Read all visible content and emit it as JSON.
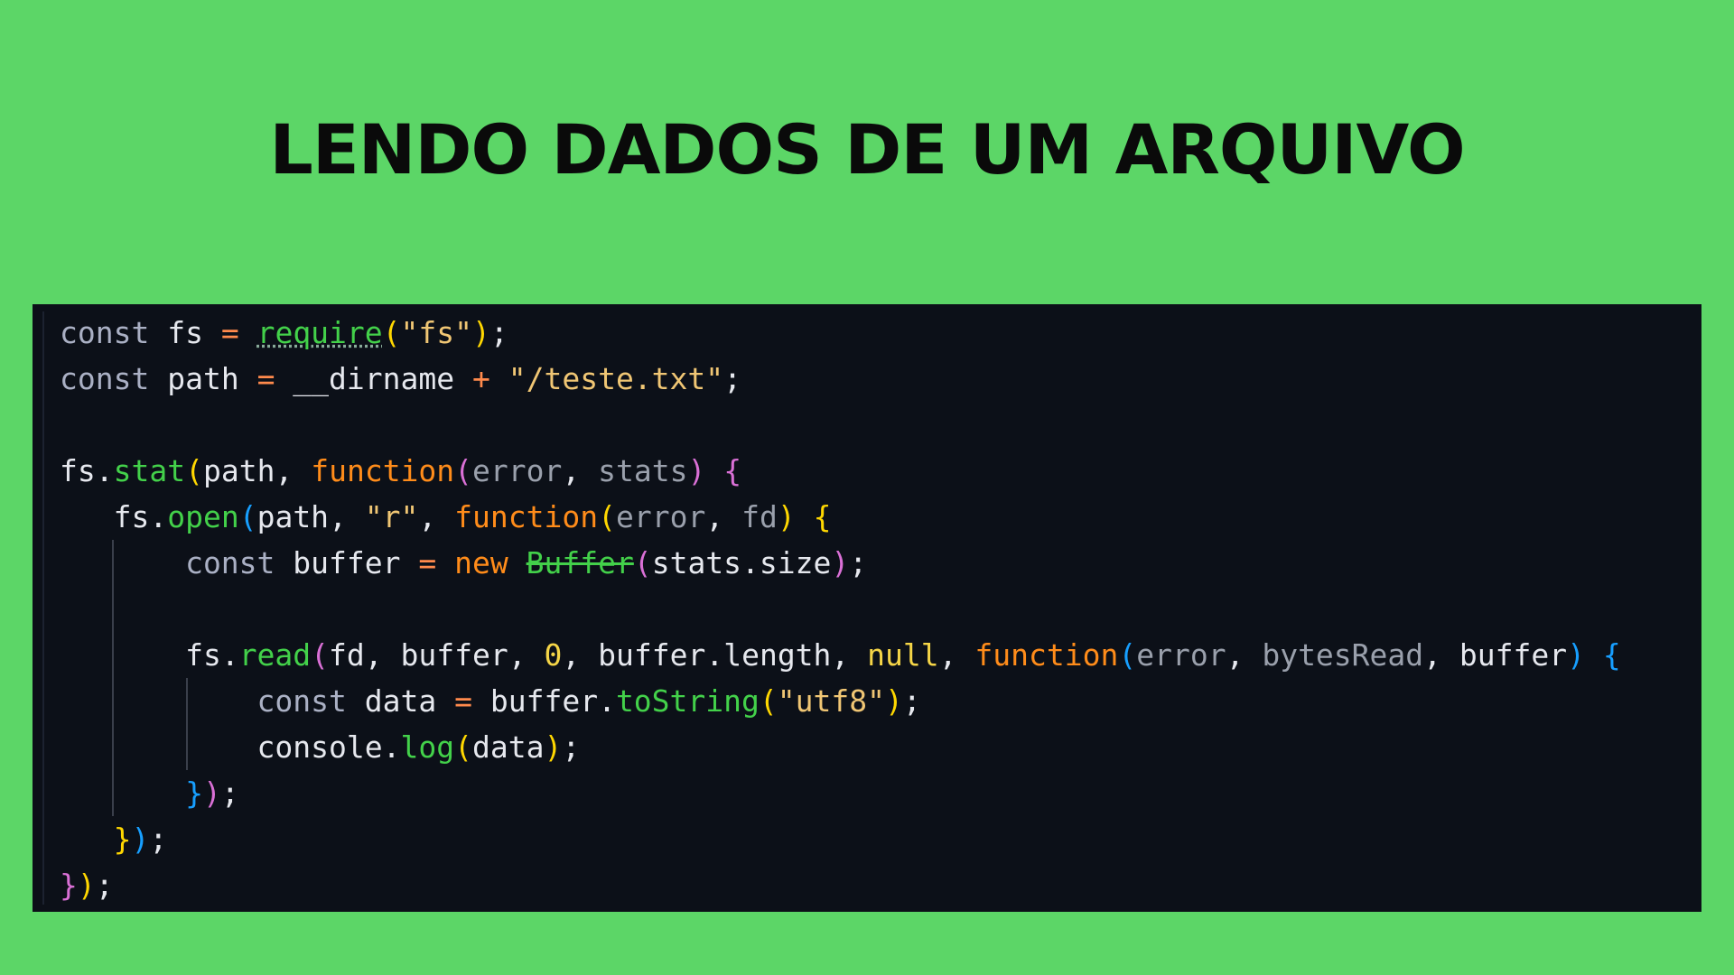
{
  "page": {
    "title": "LENDO DADOS DE UM ARQUIVO"
  },
  "colors": {
    "background": "#5cd667",
    "editor_background": "#0c1018",
    "keyword_const": "#aab0c4",
    "identifier": "#e6e8ee",
    "operator": "#ff8a4c",
    "method": "#43d14a",
    "string": "#f0c674",
    "function_keyword": "#ff8c1a",
    "parameter": "#9aa0ac",
    "number_null": "#f5d547",
    "bracket_level_1": "#ffd700",
    "bracket_level_2": "#da70d6",
    "bracket_level_3": "#179fff"
  },
  "editor": {
    "lines": [
      {
        "tokens": [
          {
            "t": "const",
            "c": "kw"
          },
          {
            "t": " fs ",
            "c": "var"
          },
          {
            "t": "=",
            "c": "op"
          },
          {
            "t": " ",
            "c": "var"
          },
          {
            "t": "require",
            "c": "fn-underline"
          },
          {
            "t": "(",
            "c": "br1"
          },
          {
            "t": "\"fs\"",
            "c": "str"
          },
          {
            "t": ")",
            "c": "br1"
          },
          {
            "t": ";",
            "c": "punct"
          }
        ]
      },
      {
        "tokens": [
          {
            "t": "const",
            "c": "kw"
          },
          {
            "t": " path ",
            "c": "var"
          },
          {
            "t": "=",
            "c": "op"
          },
          {
            "t": " __dirname ",
            "c": "var"
          },
          {
            "t": "+",
            "c": "op"
          },
          {
            "t": " ",
            "c": "var"
          },
          {
            "t": "\"/teste.txt\"",
            "c": "str"
          },
          {
            "t": ";",
            "c": "punct"
          }
        ]
      },
      {
        "tokens": []
      },
      {
        "tokens": [
          {
            "t": "fs",
            "c": "var"
          },
          {
            "t": ".",
            "c": "punct"
          },
          {
            "t": "stat",
            "c": "fn"
          },
          {
            "t": "(",
            "c": "br1"
          },
          {
            "t": "path",
            "c": "var"
          },
          {
            "t": ", ",
            "c": "punct"
          },
          {
            "t": "function",
            "c": "keyword-fn"
          },
          {
            "t": "(",
            "c": "br2"
          },
          {
            "t": "error",
            "c": "param"
          },
          {
            "t": ", ",
            "c": "punct"
          },
          {
            "t": "stats",
            "c": "param"
          },
          {
            "t": ")",
            "c": "br2"
          },
          {
            "t": " ",
            "c": "var"
          },
          {
            "t": "{",
            "c": "br2"
          }
        ]
      },
      {
        "tokens": [
          {
            "t": "   fs",
            "c": "var"
          },
          {
            "t": ".",
            "c": "punct"
          },
          {
            "t": "open",
            "c": "fn"
          },
          {
            "t": "(",
            "c": "br3"
          },
          {
            "t": "path",
            "c": "var"
          },
          {
            "t": ", ",
            "c": "punct"
          },
          {
            "t": "\"r\"",
            "c": "str"
          },
          {
            "t": ", ",
            "c": "punct"
          },
          {
            "t": "function",
            "c": "keyword-fn"
          },
          {
            "t": "(",
            "c": "br1"
          },
          {
            "t": "error",
            "c": "param"
          },
          {
            "t": ", ",
            "c": "punct"
          },
          {
            "t": "fd",
            "c": "param"
          },
          {
            "t": ")",
            "c": "br1"
          },
          {
            "t": " ",
            "c": "var"
          },
          {
            "t": "{",
            "c": "br1"
          }
        ]
      },
      {
        "guides": [
          1
        ],
        "tokens": [
          {
            "t": "       const",
            "c": "kw"
          },
          {
            "t": " buffer ",
            "c": "var"
          },
          {
            "t": "=",
            "c": "op"
          },
          {
            "t": " ",
            "c": "var"
          },
          {
            "t": "new",
            "c": "keyword-fn"
          },
          {
            "t": " ",
            "c": "var"
          },
          {
            "t": "Buffer",
            "c": "deprecated"
          },
          {
            "t": "(",
            "c": "br2"
          },
          {
            "t": "stats.size",
            "c": "var"
          },
          {
            "t": ")",
            "c": "br2"
          },
          {
            "t": ";",
            "c": "punct"
          }
        ]
      },
      {
        "guides": [
          1
        ],
        "tokens": []
      },
      {
        "guides": [
          1
        ],
        "tokens": [
          {
            "t": "       fs",
            "c": "var"
          },
          {
            "t": ".",
            "c": "punct"
          },
          {
            "t": "read",
            "c": "fn"
          },
          {
            "t": "(",
            "c": "br2"
          },
          {
            "t": "fd",
            "c": "var"
          },
          {
            "t": ", ",
            "c": "punct"
          },
          {
            "t": "buffer",
            "c": "var"
          },
          {
            "t": ", ",
            "c": "punct"
          },
          {
            "t": "0",
            "c": "num"
          },
          {
            "t": ", ",
            "c": "punct"
          },
          {
            "t": "buffer.length",
            "c": "var"
          },
          {
            "t": ", ",
            "c": "punct"
          },
          {
            "t": "null",
            "c": "null"
          },
          {
            "t": ", ",
            "c": "punct"
          },
          {
            "t": "function",
            "c": "keyword-fn"
          },
          {
            "t": "(",
            "c": "br3"
          },
          {
            "t": "error",
            "c": "param"
          },
          {
            "t": ", ",
            "c": "punct"
          },
          {
            "t": "bytesRead",
            "c": "param"
          },
          {
            "t": ", ",
            "c": "punct"
          },
          {
            "t": "buffer",
            "c": "var"
          },
          {
            "t": ")",
            "c": "br3"
          },
          {
            "t": " ",
            "c": "var"
          },
          {
            "t": "{",
            "c": "br3"
          }
        ]
      },
      {
        "guides": [
          1,
          2
        ],
        "tokens": [
          {
            "t": "           const",
            "c": "kw"
          },
          {
            "t": " data ",
            "c": "var"
          },
          {
            "t": "=",
            "c": "op"
          },
          {
            "t": " buffer",
            "c": "var"
          },
          {
            "t": ".",
            "c": "punct"
          },
          {
            "t": "toString",
            "c": "fn"
          },
          {
            "t": "(",
            "c": "br1"
          },
          {
            "t": "\"utf8\"",
            "c": "str"
          },
          {
            "t": ")",
            "c": "br1"
          },
          {
            "t": ";",
            "c": "punct"
          }
        ]
      },
      {
        "guides": [
          1,
          2
        ],
        "tokens": [
          {
            "t": "           console",
            "c": "var"
          },
          {
            "t": ".",
            "c": "punct"
          },
          {
            "t": "log",
            "c": "fn"
          },
          {
            "t": "(",
            "c": "br1"
          },
          {
            "t": "data",
            "c": "var"
          },
          {
            "t": ")",
            "c": "br1"
          },
          {
            "t": ";",
            "c": "punct"
          }
        ]
      },
      {
        "guides": [
          1
        ],
        "tokens": [
          {
            "t": "       }",
            "c": "br3"
          },
          {
            "t": ")",
            "c": "br2"
          },
          {
            "t": ";",
            "c": "punct"
          }
        ]
      },
      {
        "tokens": [
          {
            "t": "   }",
            "c": "br1"
          },
          {
            "t": ")",
            "c": "br3"
          },
          {
            "t": ";",
            "c": "punct"
          }
        ]
      },
      {
        "tokens": [
          {
            "t": "}",
            "c": "br2"
          },
          {
            "t": ")",
            "c": "br1"
          },
          {
            "t": ";",
            "c": "punct"
          }
        ]
      }
    ]
  }
}
